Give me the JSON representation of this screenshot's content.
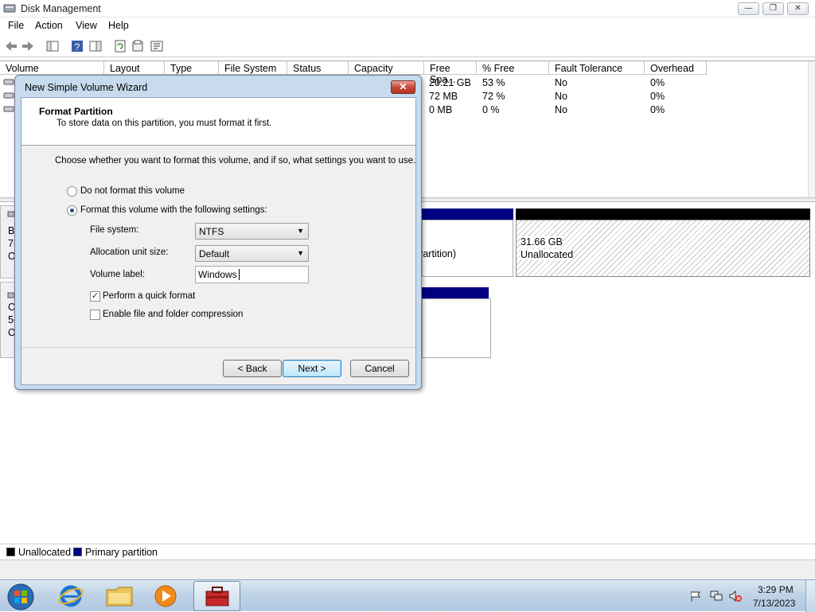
{
  "window": {
    "title": "Disk Management",
    "app_icon": "disk-management-icon"
  },
  "menu": [
    "File",
    "Action",
    "View",
    "Help"
  ],
  "toolbar_icons": [
    "back-icon",
    "forward-icon",
    "console-tree-icon",
    "help-icon",
    "show-hide-icon",
    "refresh-icon",
    "properties-icon",
    "help-topic-icon"
  ],
  "volume_table": {
    "columns": [
      "Volume",
      "Layout",
      "Type",
      "File System",
      "Status",
      "Capacity",
      "Free Spa...",
      "% Free",
      "Fault Tolerance",
      "Overhead"
    ],
    "rows": [
      {
        "free": "20.21 GB",
        "pct": "53 %",
        "fault": "No",
        "overhead": "0%"
      },
      {
        "free": "72 MB",
        "pct": "72 %",
        "fault": "No",
        "overhead": "0%"
      },
      {
        "free": "0 MB",
        "pct": "0 %",
        "fault": "No",
        "overhead": "0%"
      }
    ]
  },
  "graph": {
    "disk0_left": [
      "B",
      "7(",
      "O"
    ],
    "disk1_left": [
      "C",
      "5(",
      "O"
    ],
    "partition_fragment": "Partition)",
    "unallocated_size": "31.66 GB",
    "unallocated_label": "Unallocated"
  },
  "legend": {
    "unallocated": "Unallocated",
    "primary": "Primary partition",
    "unallocated_color": "#000000",
    "primary_color": "#000080"
  },
  "dialog": {
    "title": "New Simple Volume Wizard",
    "heading": "Format Partition",
    "subheading": "To store data on this partition, you must format it first.",
    "prompt": "Choose whether you want to format this volume, and if so, what settings you want to use.",
    "radio_no_format": "Do not format this volume",
    "radio_format": "Format this volume with the following settings:",
    "fs_label": "File system:",
    "fs_value": "NTFS",
    "alloc_label": "Allocation unit size:",
    "alloc_value": "Default",
    "vol_label": "Volume label:",
    "vol_value": "Windows",
    "quick_format": "Perform a quick format",
    "compression": "Enable file and folder compression",
    "back": "< Back",
    "next": "Next >",
    "cancel": "Cancel"
  },
  "taskbar": {
    "time": "3:29 PM",
    "date": "7/13/2023",
    "apps": [
      "internet-explorer-icon",
      "file-explorer-icon",
      "media-player-icon",
      "computer-management-icon"
    ]
  }
}
